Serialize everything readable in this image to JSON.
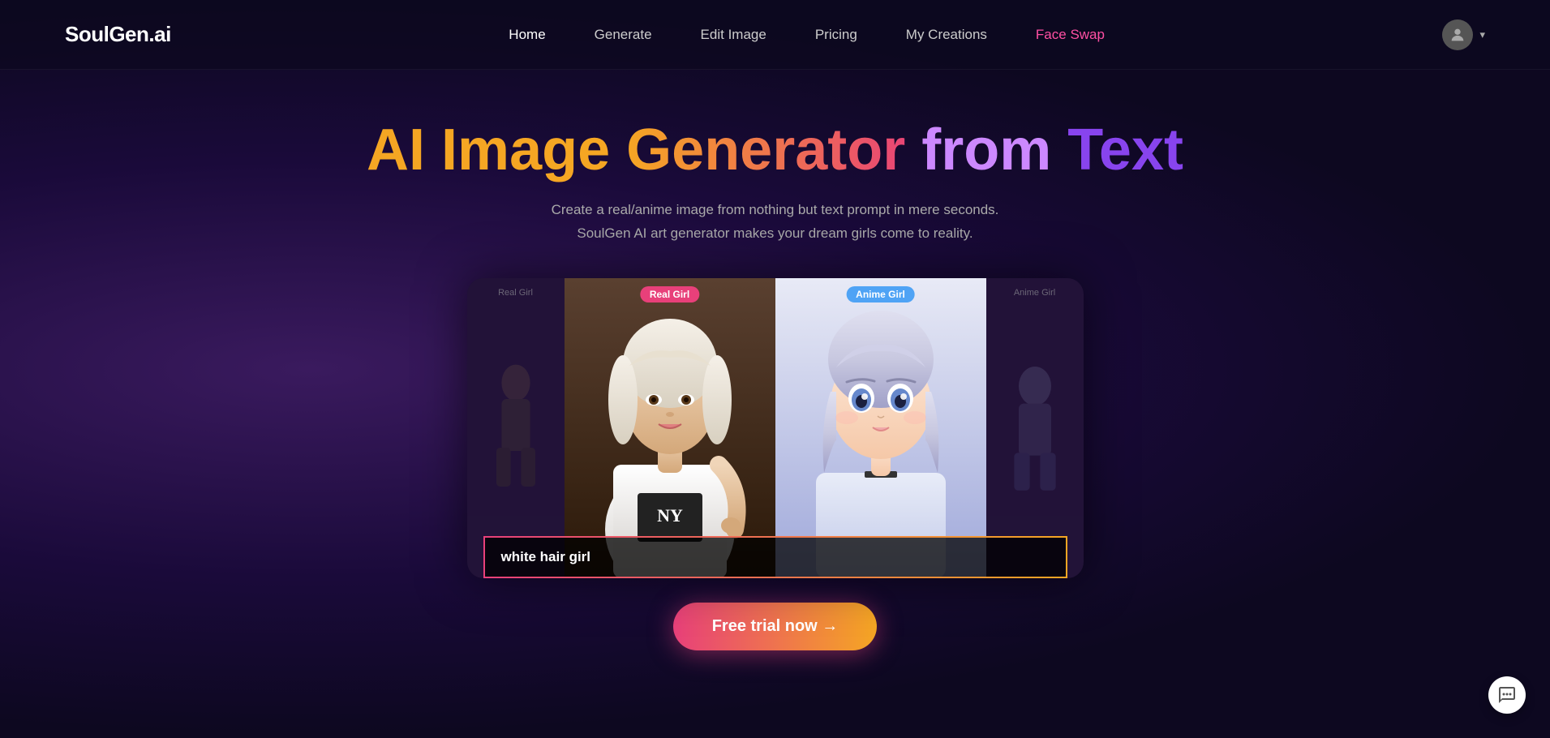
{
  "brand": {
    "name": "SoulGen.ai"
  },
  "nav": {
    "links": [
      {
        "label": "Home",
        "href": "#",
        "class": "active"
      },
      {
        "label": "Generate",
        "href": "#",
        "class": ""
      },
      {
        "label": "Edit Image",
        "href": "#",
        "class": ""
      },
      {
        "label": "Pricing",
        "href": "#",
        "class": ""
      },
      {
        "label": "My Creations",
        "href": "#",
        "class": ""
      },
      {
        "label": "Face Swap",
        "href": "#",
        "class": "face-swap"
      }
    ]
  },
  "hero": {
    "title_part1": "AI Image Generator from Text",
    "title_ai": "AI ",
    "title_image": "Image ",
    "title_generator": "Generator ",
    "title_from": "from ",
    "title_text": "Text",
    "subtitle_line1": "Create a real/anime image from nothing but text prompt in mere seconds.",
    "subtitle_line2": "SoulGen AI art generator makes your dream girls come to reality.",
    "prompt_placeholder": "white hair girl",
    "cta_button": "Free trial now →",
    "badge_real": "Real Girl",
    "badge_anime": "Anime Girl",
    "side_label_real": "Real Girl",
    "side_label_anime": "Anime Girl"
  },
  "chat_widget": {
    "icon": "💬"
  }
}
